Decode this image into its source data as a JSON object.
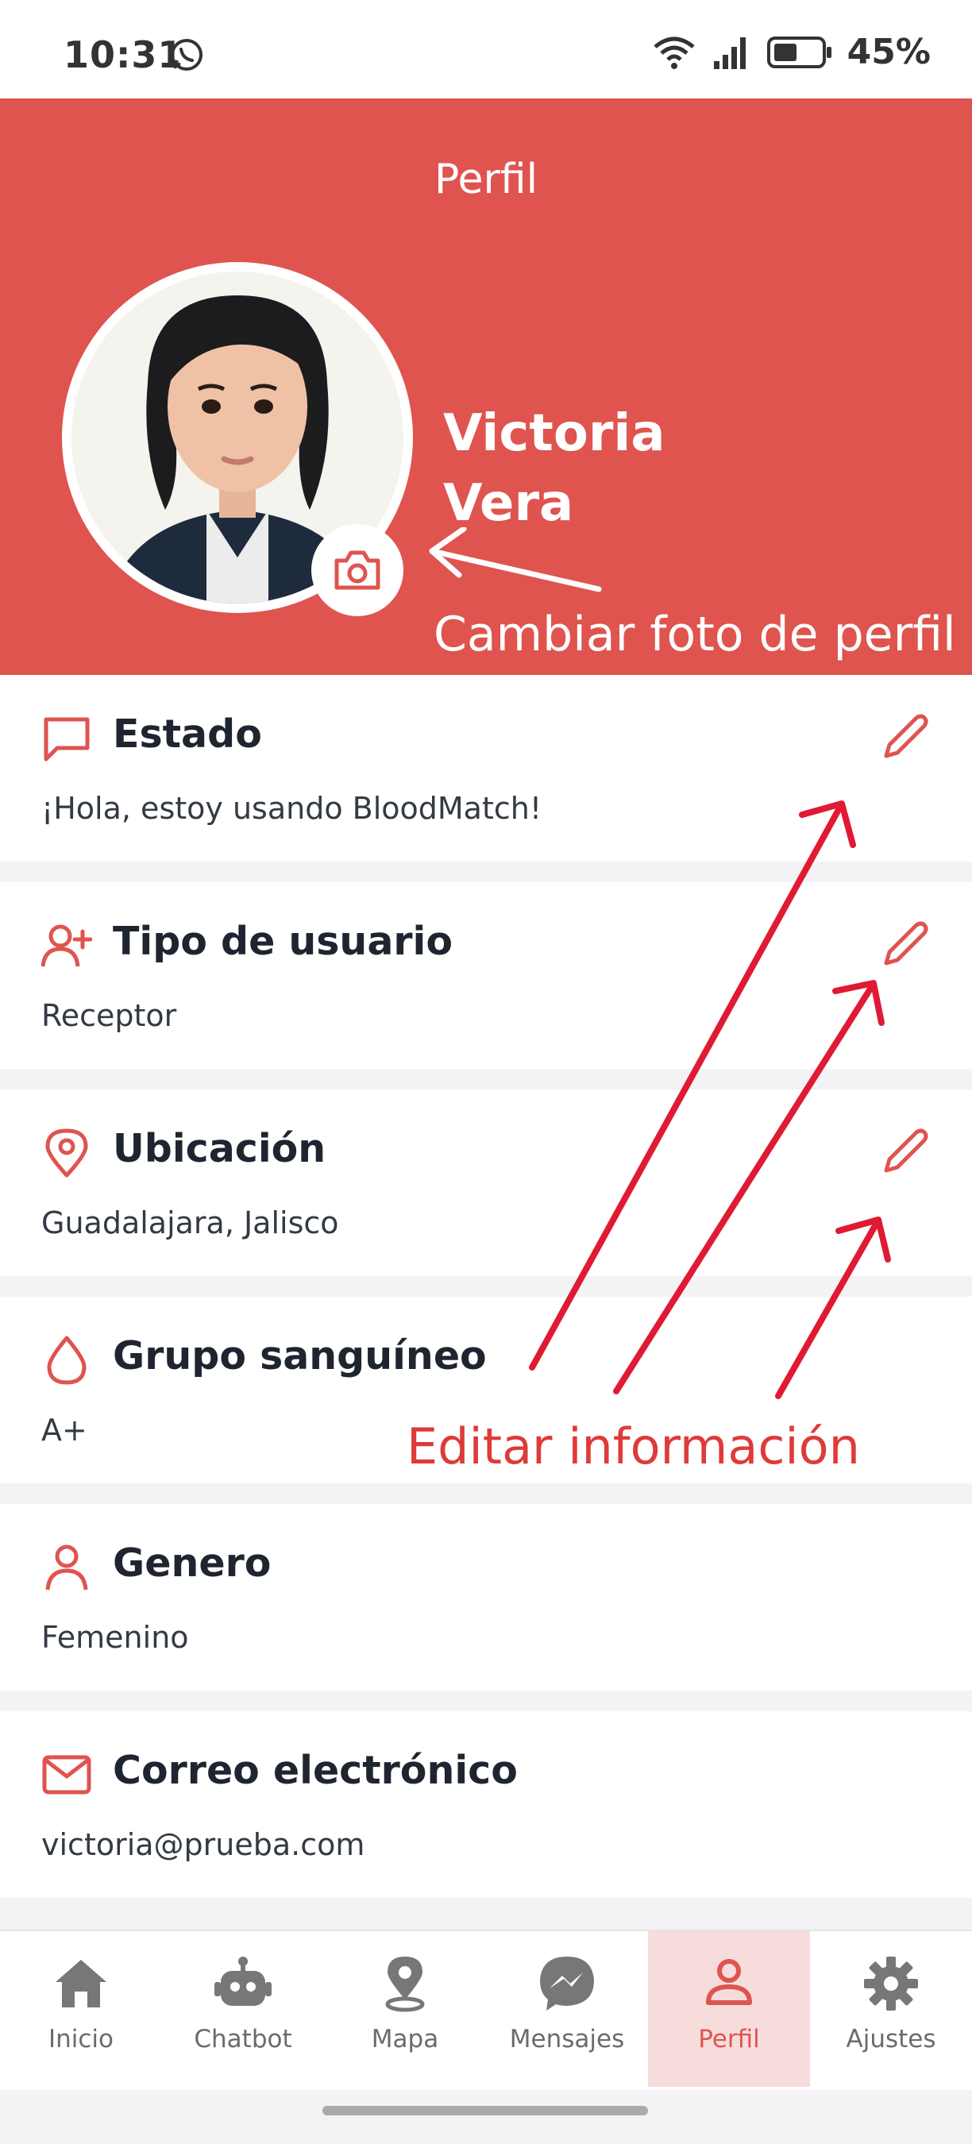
{
  "status_bar": {
    "time": "10:31",
    "battery": "45%",
    "icons": [
      "whatsapp-icon",
      "wifi-icon",
      "signal-icon",
      "battery-icon"
    ]
  },
  "header": {
    "title": "Perfil",
    "first_name": "Victoria",
    "last_name": "Vera",
    "avatar": "avatar-illustration",
    "camera_icon": "camera-icon"
  },
  "annotations": {
    "change_photo": "Cambiar foto de perfil",
    "edit_info": "Editar información"
  },
  "sections": [
    {
      "title": "Estado",
      "value": "¡Hola, estoy usando BloodMatch!",
      "icon": "message-icon",
      "editable": true
    },
    {
      "title": "Tipo de usuario",
      "value": "Receptor",
      "icon": "user-plus-icon",
      "editable": true
    },
    {
      "title": "Ubicación",
      "value": "Guadalajara, Jalisco",
      "icon": "map-pin-icon",
      "editable": true
    },
    {
      "title": "Grupo sanguíneo",
      "value": "A+",
      "icon": "droplet-icon",
      "editable": false
    },
    {
      "title": "Genero",
      "value": "Femenino",
      "icon": "user-icon",
      "editable": false
    },
    {
      "title": "Correo electrónico",
      "value": "victoria@prueba.com",
      "icon": "mail-icon",
      "editable": false
    }
  ],
  "bottom_nav": [
    {
      "label": "Inicio",
      "icon": "home-icon",
      "active": false
    },
    {
      "label": "Chatbot",
      "icon": "robot-icon",
      "active": false
    },
    {
      "label": "Mapa",
      "icon": "location-icon",
      "active": false
    },
    {
      "label": "Mensajes",
      "icon": "messenger-icon",
      "active": false
    },
    {
      "label": "Perfil",
      "icon": "profile-icon",
      "active": true
    },
    {
      "label": "Ajustes",
      "icon": "settings-icon",
      "active": false
    }
  ],
  "colors": {
    "primary": "#df544f",
    "annotation_red": "#df3a3a",
    "background": "#f3f3f5",
    "text": "#1f2530"
  }
}
